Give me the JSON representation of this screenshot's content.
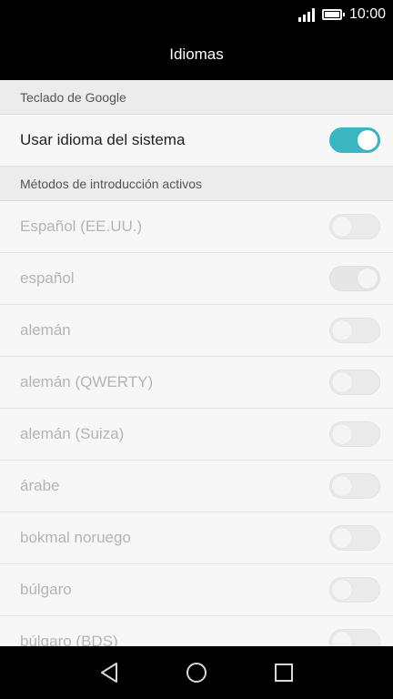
{
  "status_bar": {
    "time": "10:00",
    "signal_icon": "signal-icon",
    "battery_icon": "battery-icon"
  },
  "header": {
    "title": "Idiomas"
  },
  "sections": {
    "keyboard": {
      "header": "Teclado de Google",
      "use_system_language": {
        "label": "Usar idioma del sistema",
        "enabled": true
      }
    },
    "active_methods": {
      "header": "Métodos de introducción activos",
      "items": [
        {
          "label": "Español (EE.UU.)",
          "on": false
        },
        {
          "label": "español",
          "on": true
        },
        {
          "label": "alemán",
          "on": false
        },
        {
          "label": "alemán (QWERTY)",
          "on": false
        },
        {
          "label": "alemán (Suiza)",
          "on": false
        },
        {
          "label": "árabe",
          "on": false
        },
        {
          "label": "bokmal noruego",
          "on": false
        },
        {
          "label": "búlgaro",
          "on": false
        },
        {
          "label": "búlgaro (BDS)",
          "on": false
        }
      ]
    }
  },
  "navigation": {
    "back_icon": "back-icon",
    "home_icon": "home-icon",
    "recents_icon": "recents-icon"
  },
  "colors": {
    "accent": "#3bb6c0",
    "disabled_text": "#b4b4b4"
  }
}
